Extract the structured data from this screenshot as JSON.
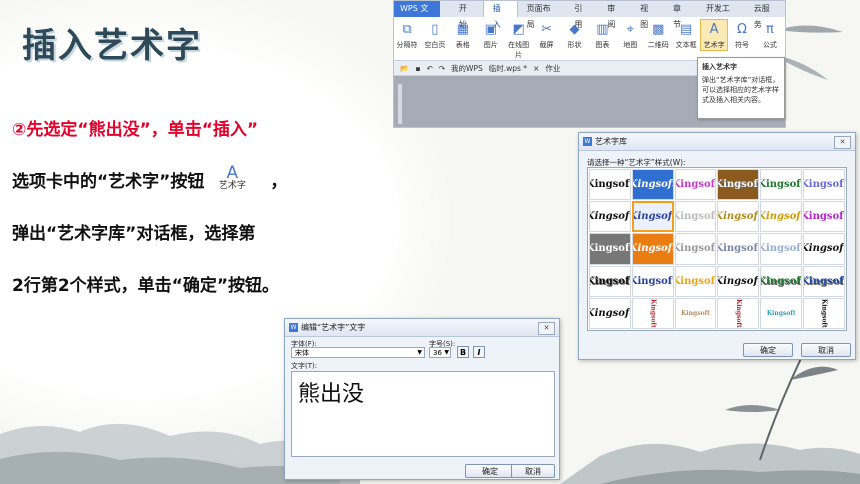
{
  "slide": {
    "title": "插入艺术字",
    "instruction": {
      "circle_num": "②",
      "p1": "先选定“熊出没”，单击“插入”",
      "p2a": "选项卡中的“艺术字”按钮",
      "p2_icon_glyph": "A",
      "p2_icon_label": "艺术字",
      "p2b": "，",
      "p3": "弹出“艺术字库”对话框，选择第",
      "p4": "2行第2个样式，单击“确定”按钮。"
    }
  },
  "wps": {
    "app_label": "WPS 文字",
    "tabs": [
      "开始",
      "插入",
      "页面布局",
      "引用",
      "审阅",
      "视图",
      "章节",
      "开发工具",
      "云服务"
    ],
    "ribbon": [
      "分隔符",
      "空白页",
      "表格",
      "图片",
      "在线图片",
      "截屏",
      "形状",
      "图表",
      "地图",
      "二维码",
      "文本框",
      "艺术字",
      "符号",
      "公式"
    ],
    "doc_tabs": [
      "我的WPS",
      "临时.wps *",
      "作业"
    ],
    "tooltip_title": "插入艺术字",
    "tooltip_body": "弹出“艺术字库”对话框，可以选择相应的艺术字样式及插入相关内容。"
  },
  "gallery": {
    "title": "艺术字库",
    "prompt": "请选择一种“艺术字”样式(W):",
    "sample_text": "Kingsoft",
    "selected": [
      1,
      1
    ],
    "ok": "确定",
    "cancel": "取消"
  },
  "edit": {
    "title": "编辑“艺术字”文字",
    "font_label": "字体(F):",
    "font_value": "宋体",
    "size_label": "字号(S):",
    "size_value": "36",
    "bold": "B",
    "italic": "I",
    "text_label": "文字(T):",
    "text_value": "熊出没",
    "ok": "确定",
    "cancel": "取消"
  },
  "colors": {
    "accent_red": "#e4002b",
    "wps_blue": "#3d78d8",
    "title_color": "#2e4a58"
  }
}
